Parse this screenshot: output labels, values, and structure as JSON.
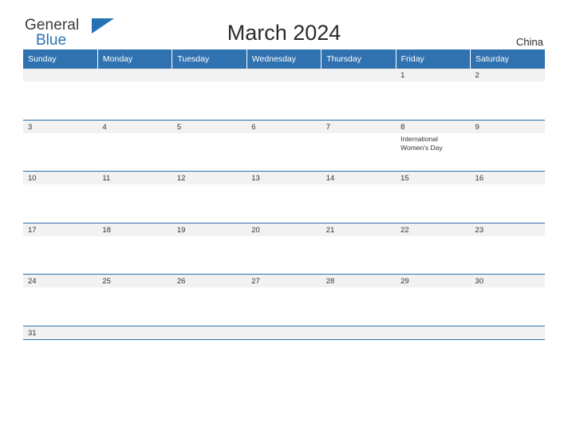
{
  "logo": {
    "word_one": "General",
    "word_two": "Blue",
    "triangle_color": "#2572b6"
  },
  "header": {
    "title": "March 2024",
    "country": "China"
  },
  "calendar": {
    "header_color": "#3072b0",
    "grid_line_color": "#2d6ea8",
    "shaded_row_color": "#f2f2f2",
    "weekdays": [
      "Sunday",
      "Monday",
      "Tuesday",
      "Wednesday",
      "Thursday",
      "Friday",
      "Saturday"
    ],
    "weeks": [
      [
        {
          "day": "",
          "event": ""
        },
        {
          "day": "",
          "event": ""
        },
        {
          "day": "",
          "event": ""
        },
        {
          "day": "",
          "event": ""
        },
        {
          "day": "",
          "event": ""
        },
        {
          "day": "1",
          "event": ""
        },
        {
          "day": "2",
          "event": ""
        }
      ],
      [
        {
          "day": "3",
          "event": ""
        },
        {
          "day": "4",
          "event": ""
        },
        {
          "day": "5",
          "event": ""
        },
        {
          "day": "6",
          "event": ""
        },
        {
          "day": "7",
          "event": ""
        },
        {
          "day": "8",
          "event": "International Women's Day"
        },
        {
          "day": "9",
          "event": ""
        }
      ],
      [
        {
          "day": "10",
          "event": ""
        },
        {
          "day": "11",
          "event": ""
        },
        {
          "day": "12",
          "event": ""
        },
        {
          "day": "13",
          "event": ""
        },
        {
          "day": "14",
          "event": ""
        },
        {
          "day": "15",
          "event": ""
        },
        {
          "day": "16",
          "event": ""
        }
      ],
      [
        {
          "day": "17",
          "event": ""
        },
        {
          "day": "18",
          "event": ""
        },
        {
          "day": "19",
          "event": ""
        },
        {
          "day": "20",
          "event": ""
        },
        {
          "day": "21",
          "event": ""
        },
        {
          "day": "22",
          "event": ""
        },
        {
          "day": "23",
          "event": ""
        }
      ],
      [
        {
          "day": "24",
          "event": ""
        },
        {
          "day": "25",
          "event": ""
        },
        {
          "day": "26",
          "event": ""
        },
        {
          "day": "27",
          "event": ""
        },
        {
          "day": "28",
          "event": ""
        },
        {
          "day": "29",
          "event": ""
        },
        {
          "day": "30",
          "event": ""
        }
      ],
      [
        {
          "day": "31",
          "event": ""
        },
        {
          "day": "",
          "event": ""
        },
        {
          "day": "",
          "event": ""
        },
        {
          "day": "",
          "event": ""
        },
        {
          "day": "",
          "event": ""
        },
        {
          "day": "",
          "event": ""
        },
        {
          "day": "",
          "event": ""
        }
      ]
    ]
  }
}
